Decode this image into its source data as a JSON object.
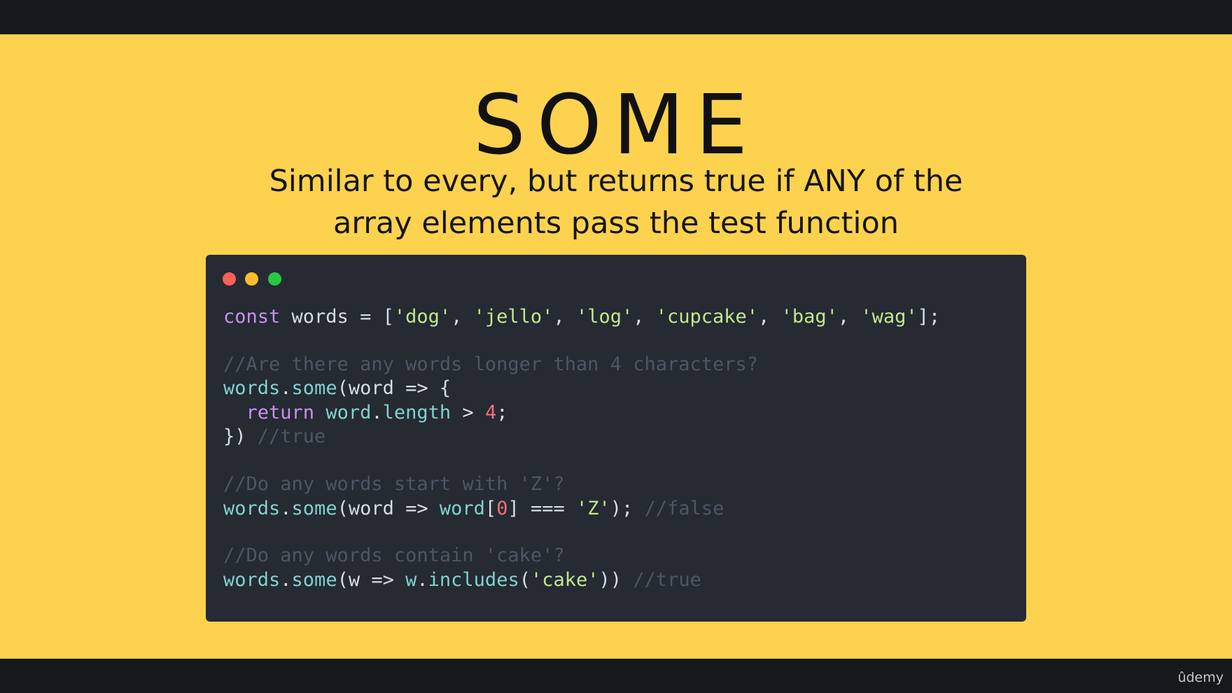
{
  "slide": {
    "title": "SOME",
    "subtitle_line1": "Similar to every, but returns true if ANY of the",
    "subtitle_line2": "array elements pass the test function",
    "background_color": "#fdd24e"
  },
  "code_window": {
    "lines": [
      {
        "tokens": [
          {
            "t": "const",
            "c": "k"
          },
          {
            "t": " words = [",
            "c": "p"
          },
          {
            "t": "'dog'",
            "c": "s"
          },
          {
            "t": ", ",
            "c": "p"
          },
          {
            "t": "'jello'",
            "c": "s"
          },
          {
            "t": ", ",
            "c": "p"
          },
          {
            "t": "'log'",
            "c": "s"
          },
          {
            "t": ", ",
            "c": "p"
          },
          {
            "t": "'cupcake'",
            "c": "s"
          },
          {
            "t": ", ",
            "c": "p"
          },
          {
            "t": "'bag'",
            "c": "s"
          },
          {
            "t": ", ",
            "c": "p"
          },
          {
            "t": "'wag'",
            "c": "s"
          },
          {
            "t": "];",
            "c": "p"
          }
        ]
      },
      {
        "blank": true
      },
      {
        "tokens": [
          {
            "t": "//Are there any words longer than 4 characters?",
            "c": "c"
          }
        ]
      },
      {
        "tokens": [
          {
            "t": "words",
            "c": "f"
          },
          {
            "t": ".",
            "c": "p"
          },
          {
            "t": "some",
            "c": "f"
          },
          {
            "t": "(word => {",
            "c": "p"
          }
        ]
      },
      {
        "tokens": [
          {
            "t": "  ",
            "c": "p"
          },
          {
            "t": "return",
            "c": "k"
          },
          {
            "t": " ",
            "c": "p"
          },
          {
            "t": "word",
            "c": "f"
          },
          {
            "t": ".",
            "c": "p"
          },
          {
            "t": "length",
            "c": "f"
          },
          {
            "t": " > ",
            "c": "p"
          },
          {
            "t": "4",
            "c": "n"
          },
          {
            "t": ";",
            "c": "p"
          }
        ]
      },
      {
        "tokens": [
          {
            "t": "}) ",
            "c": "p"
          },
          {
            "t": "//true",
            "c": "c"
          }
        ]
      },
      {
        "blank": true
      },
      {
        "tokens": [
          {
            "t": "//Do any words start with 'Z'?",
            "c": "c"
          }
        ]
      },
      {
        "tokens": [
          {
            "t": "words",
            "c": "f"
          },
          {
            "t": ".",
            "c": "p"
          },
          {
            "t": "some",
            "c": "f"
          },
          {
            "t": "(word => ",
            "c": "p"
          },
          {
            "t": "word",
            "c": "f"
          },
          {
            "t": "[",
            "c": "p"
          },
          {
            "t": "0",
            "c": "n"
          },
          {
            "t": "] === ",
            "c": "p"
          },
          {
            "t": "'Z'",
            "c": "s"
          },
          {
            "t": "); ",
            "c": "p"
          },
          {
            "t": "//false",
            "c": "c"
          }
        ]
      },
      {
        "blank": true
      },
      {
        "tokens": [
          {
            "t": "//Do any words contain 'cake'?",
            "c": "c"
          }
        ]
      },
      {
        "tokens": [
          {
            "t": "words",
            "c": "f"
          },
          {
            "t": ".",
            "c": "p"
          },
          {
            "t": "some",
            "c": "f"
          },
          {
            "t": "(w => ",
            "c": "p"
          },
          {
            "t": "w",
            "c": "f"
          },
          {
            "t": ".",
            "c": "p"
          },
          {
            "t": "includes",
            "c": "f"
          },
          {
            "t": "(",
            "c": "p"
          },
          {
            "t": "'cake'",
            "c": "s"
          },
          {
            "t": ")) ",
            "c": "p"
          },
          {
            "t": "//true",
            "c": "c"
          }
        ]
      }
    ]
  },
  "brand": {
    "label": "ûdemy"
  }
}
